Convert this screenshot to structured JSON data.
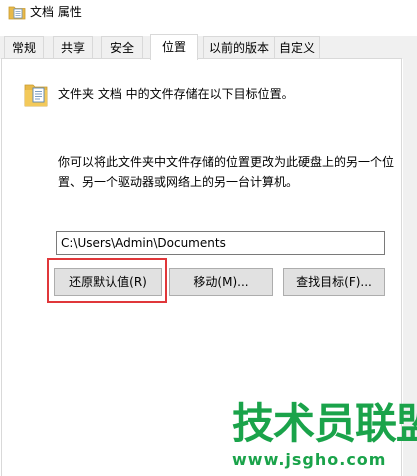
{
  "window": {
    "title": "文档 属性"
  },
  "tabs": [
    {
      "label": "常规",
      "active": false
    },
    {
      "label": "共享",
      "active": false
    },
    {
      "label": "安全",
      "active": false
    },
    {
      "label": "位置",
      "active": true
    },
    {
      "label": "以前的版本",
      "active": false
    },
    {
      "label": "自定义",
      "active": false
    }
  ],
  "location": {
    "description": "文件夹 文档 中的文件存储在以下目标位置。",
    "explanation": "你可以将此文件夹中文件存储的位置更改为此硬盘上的另一个位置、另一个驱动器或网络上的另一台计算机。",
    "path_value": "C:\\Users\\Admin\\Documents",
    "buttons": {
      "restore_default": "还原默认值(R)",
      "move": "移动(M)...",
      "find_target": "查找目标(F)..."
    }
  },
  "watermark": {
    "text": "技术员联盟",
    "url": "www.jsgho.com"
  },
  "colors": {
    "highlight": "#e0373a",
    "watermark": "#1aa34a",
    "button_bg": "#e1e1e1",
    "tab_bg": "#f0f0f0"
  },
  "icons": {
    "title": "folder-doc-icon",
    "location": "folder-doc-icon"
  }
}
